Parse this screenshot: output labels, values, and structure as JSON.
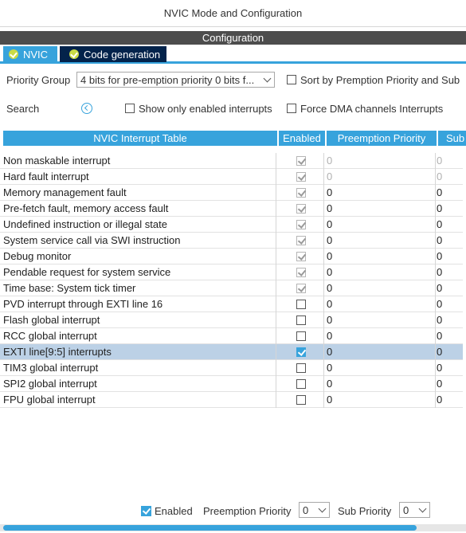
{
  "window": {
    "title": "NVIC Mode and Configuration"
  },
  "section": {
    "header": "Configuration"
  },
  "tabs": [
    {
      "label": "NVIC",
      "active": true,
      "icon": "check-circle-icon"
    },
    {
      "label": "Code generation",
      "active": false,
      "icon": "check-circle-icon"
    }
  ],
  "controls": {
    "priority_group_label": "Priority Group",
    "priority_group_value": "4 bits for pre-emption priority 0 bits f...",
    "sort_label": "Sort by Premption Priority and Sub",
    "sort_checked": false,
    "search_label": "Search",
    "show_enabled_label": "Show only enabled interrupts",
    "show_enabled_checked": false,
    "force_dma_label": "Force DMA channels Interrupts",
    "force_dma_checked": false
  },
  "table": {
    "headers": [
      "NVIC Interrupt Table",
      "Enabled",
      "Preemption Priority",
      "Sub"
    ],
    "rows": [
      {
        "name": "Non maskable interrupt",
        "enabled": true,
        "locked": true,
        "preemption": "0",
        "sub": "0",
        "muted": true
      },
      {
        "name": "Hard fault interrupt",
        "enabled": true,
        "locked": true,
        "preemption": "0",
        "sub": "0",
        "muted": true
      },
      {
        "name": "Memory management fault",
        "enabled": true,
        "locked": true,
        "preemption": "0",
        "sub": "0",
        "muted": false
      },
      {
        "name": "Pre-fetch fault, memory access fault",
        "enabled": true,
        "locked": true,
        "preemption": "0",
        "sub": "0",
        "muted": false
      },
      {
        "name": "Undefined instruction or illegal state",
        "enabled": true,
        "locked": true,
        "preemption": "0",
        "sub": "0",
        "muted": false
      },
      {
        "name": "System service call via SWI instruction",
        "enabled": true,
        "locked": true,
        "preemption": "0",
        "sub": "0",
        "muted": false
      },
      {
        "name": "Debug monitor",
        "enabled": true,
        "locked": true,
        "preemption": "0",
        "sub": "0",
        "muted": false
      },
      {
        "name": "Pendable request for system service",
        "enabled": true,
        "locked": true,
        "preemption": "0",
        "sub": "0",
        "muted": false
      },
      {
        "name": "Time base: System tick timer",
        "enabled": true,
        "locked": true,
        "preemption": "0",
        "sub": "0",
        "muted": false
      },
      {
        "name": "PVD interrupt through EXTI line 16",
        "enabled": false,
        "locked": false,
        "preemption": "0",
        "sub": "0",
        "muted": false
      },
      {
        "name": "Flash global interrupt",
        "enabled": false,
        "locked": false,
        "preemption": "0",
        "sub": "0",
        "muted": false
      },
      {
        "name": "RCC global interrupt",
        "enabled": false,
        "locked": false,
        "preemption": "0",
        "sub": "0",
        "muted": false
      },
      {
        "name": "EXTI line[9:5] interrupts",
        "enabled": true,
        "locked": false,
        "preemption": "0",
        "sub": "0",
        "muted": false,
        "selected": true
      },
      {
        "name": "TIM3 global interrupt",
        "enabled": false,
        "locked": false,
        "preemption": "0",
        "sub": "0",
        "muted": false
      },
      {
        "name": "SPI2 global interrupt",
        "enabled": false,
        "locked": false,
        "preemption": "0",
        "sub": "0",
        "muted": false
      },
      {
        "name": "FPU global interrupt",
        "enabled": false,
        "locked": false,
        "preemption": "0",
        "sub": "0",
        "muted": false
      }
    ]
  },
  "footer": {
    "enabled_label": "Enabled",
    "enabled_checked": true,
    "preemption_label": "Preemption Priority",
    "preemption_value": "0",
    "sub_label": "Sub Priority",
    "sub_value": "0"
  },
  "scroll": {
    "horizontal_thumb_fraction": 0.9
  },
  "colors": {
    "accent": "#37a3dc",
    "tab_dark": "#03234b",
    "header_bar": "#4d4d4d",
    "selected_row": "#bcd1e6",
    "tab_check": "#c9db46"
  }
}
